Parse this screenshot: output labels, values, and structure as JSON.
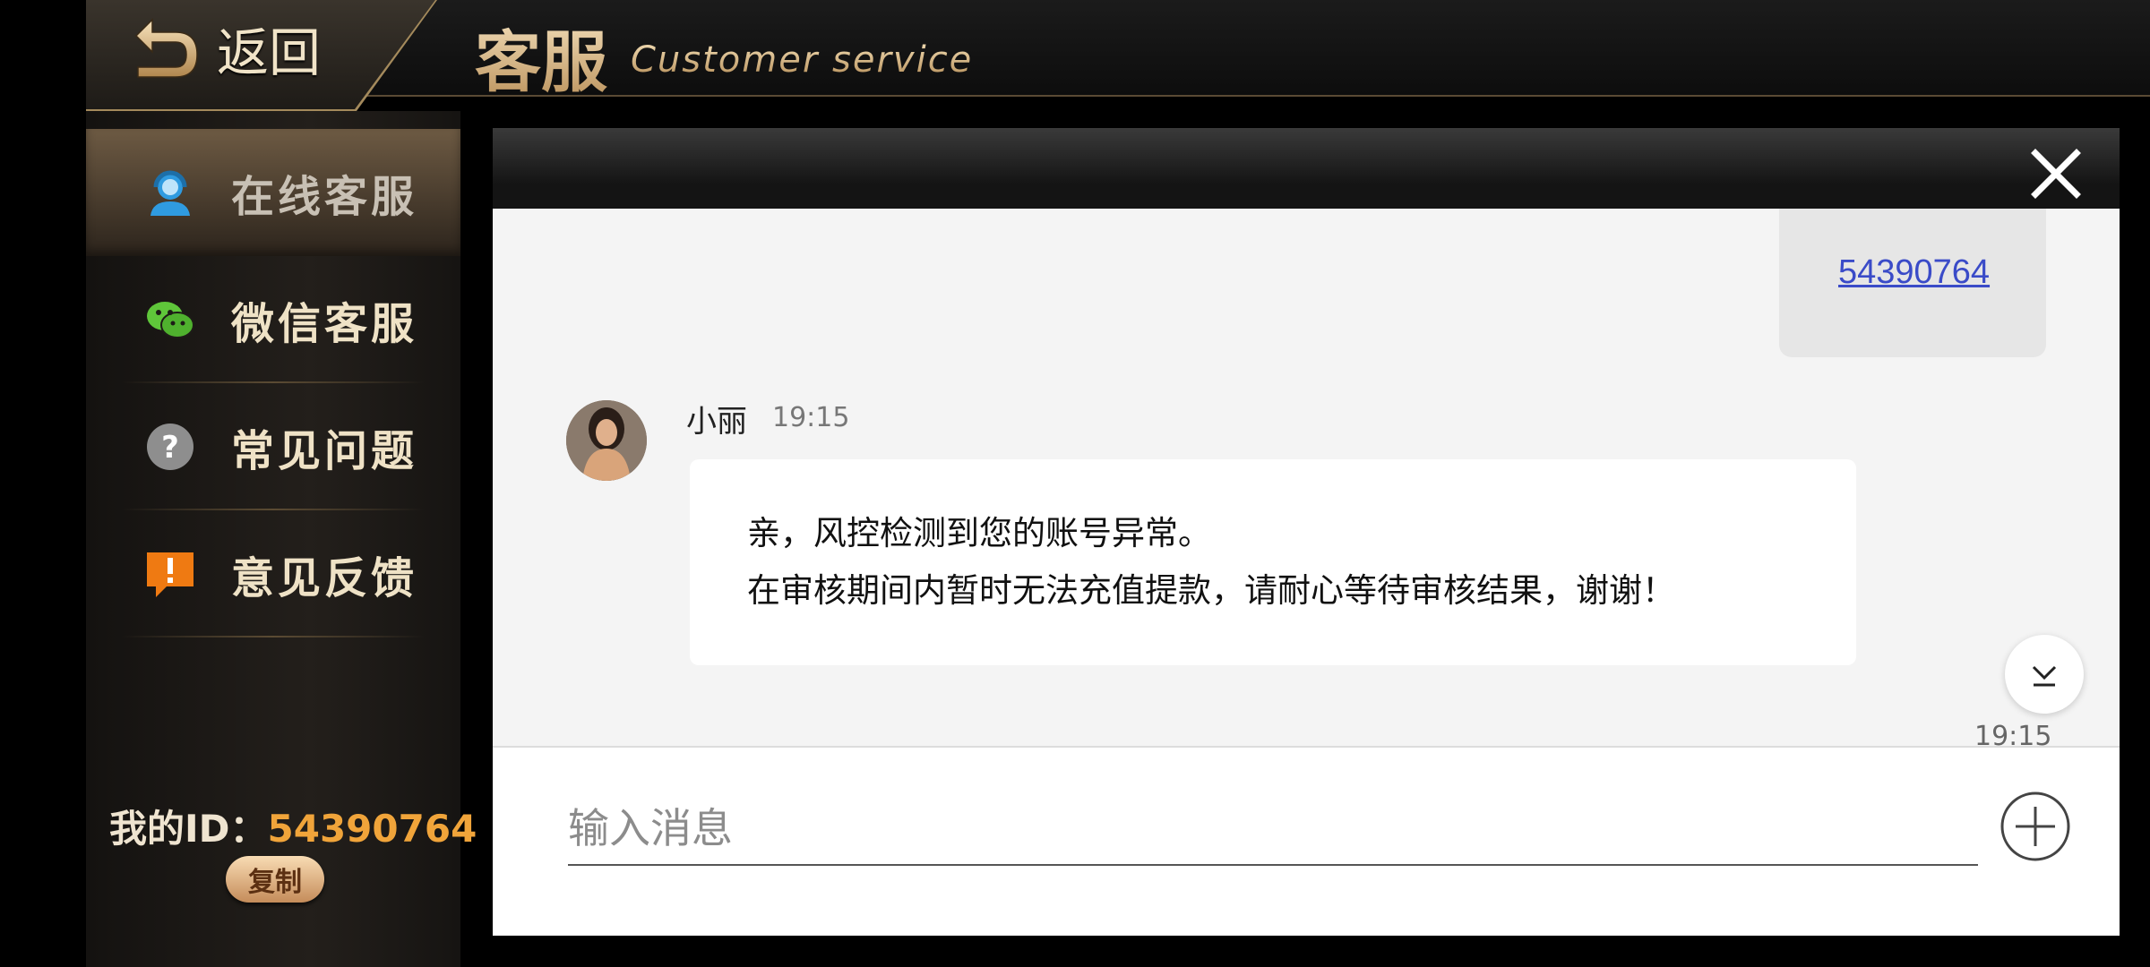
{
  "header": {
    "back_label": "返回",
    "title_cn": "客服",
    "title_en": "Customer service"
  },
  "sidebar": {
    "items": [
      {
        "label": "在线客服",
        "icon": "support-agent-icon",
        "active": true
      },
      {
        "label": "微信客服",
        "icon": "wechat-icon",
        "active": false
      },
      {
        "label": "常见问题",
        "icon": "question-icon",
        "active": false
      },
      {
        "label": "意见反馈",
        "icon": "feedback-icon",
        "active": false
      }
    ],
    "my_id_label": "我的ID：",
    "my_id_value": "54390764",
    "copy_label": "复制"
  },
  "chat": {
    "my_message_link": "54390764",
    "agent_name": "小丽",
    "agent_time": "19:15",
    "agent_lines": [
      "亲，风控检测到您的账号异常。",
      "在审核期间内暂时无法充值提款，请耐心等待审核结果，谢谢！"
    ],
    "bottom_time": "19:15"
  },
  "input": {
    "placeholder": "输入消息",
    "value": ""
  },
  "colors": {
    "accent_gold": "#e9cfa0",
    "id_orange": "#f0a43a",
    "link_blue": "#3a4bc8"
  }
}
